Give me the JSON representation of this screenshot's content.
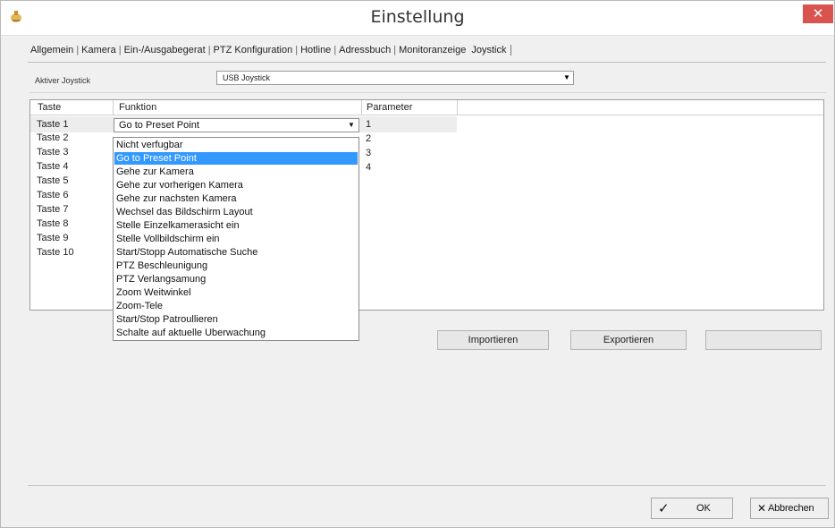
{
  "window": {
    "title": "Einstellung",
    "close_glyph": "✕"
  },
  "tabs": [
    {
      "label": "Allgemein"
    },
    {
      "label": "Kamera"
    },
    {
      "label": "Ein-/Ausgabegerat"
    },
    {
      "label": "PTZ Konfiguration"
    },
    {
      "label": "Hotline"
    },
    {
      "label": "Adressbuch"
    },
    {
      "label": "Monitoranzeige"
    },
    {
      "label": "Joystick"
    }
  ],
  "active_tab": "Joystick",
  "joystick": {
    "label": "Aktiver Joystick",
    "value": "USB Joystick"
  },
  "grid": {
    "columns": [
      "Taste",
      "Funktion",
      "Parameter"
    ],
    "rows": [
      {
        "taste": "Taste 1",
        "funktion": "Go to Preset Point",
        "parameter": "1"
      },
      {
        "taste": "Taste 2",
        "parameter": "2"
      },
      {
        "taste": "Taste 3",
        "parameter": "3"
      },
      {
        "taste": "Taste 4",
        "parameter": "4"
      },
      {
        "taste": "Taste 5"
      },
      {
        "taste": "Taste 6"
      },
      {
        "taste": "Taste 7"
      },
      {
        "taste": "Taste 8"
      },
      {
        "taste": "Taste 9"
      },
      {
        "taste": "Taste 10"
      }
    ]
  },
  "dropdown": {
    "selected": "Go to Preset Point",
    "options": [
      "Nicht verfugbar",
      "Go to Preset Point",
      "Gehe zur Kamera",
      "Gehe zur vorherigen Kamera",
      "Gehe zur nachsten Kamera",
      "Wechsel das Bildschirm Layout",
      "Stelle Einzelkamerasicht ein",
      "Stelle Vollbildschirm ein",
      "Start/Stopp Automatische Suche",
      "PTZ Beschleunigung",
      "PTZ Verlangsamung",
      "Zoom Weitwinkel",
      "Zoom-Tele",
      "Start/Stop Patroullieren",
      "Schalte auf aktuelle Uberwachung"
    ]
  },
  "buttons": {
    "import": "Importieren",
    "export": "Exportieren",
    "blank": "",
    "ok": "OK",
    "cancel": "Abbrechen"
  },
  "colors": {
    "accent": "#3399ff",
    "close": "#d9534f"
  }
}
